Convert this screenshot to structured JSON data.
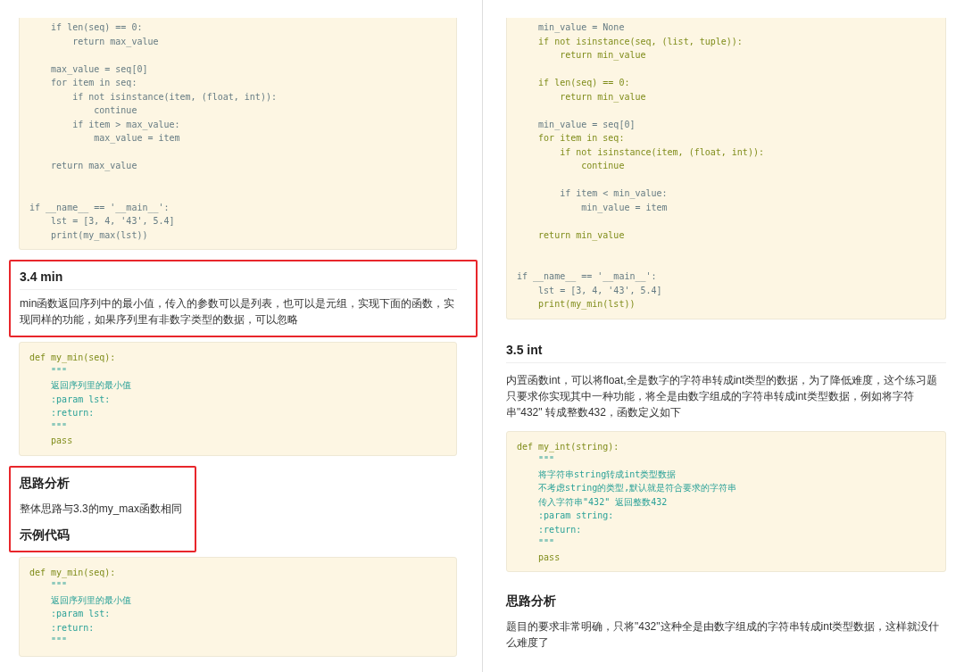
{
  "columns": [
    {
      "blocks": [
        {
          "kind": "code_continued",
          "lines": [
            {
              "kind": "plain",
              "text": "    if len(seq) == 0:"
            },
            {
              "kind": "plain",
              "text": "        return max_value"
            },
            {
              "kind": "blank"
            },
            {
              "kind": "plain",
              "text": "    max_value = seq[0]"
            },
            {
              "kind": "plain",
              "text": "    for item in seq:"
            },
            {
              "kind": "plain",
              "text": "        if not isinstance(item, (float, int)):"
            },
            {
              "kind": "plain",
              "text": "            continue"
            },
            {
              "kind": "plain",
              "text": "        if item > max_value:"
            },
            {
              "kind": "plain",
              "text": "            max_value = item"
            },
            {
              "kind": "blank"
            },
            {
              "kind": "plain",
              "text": "    return max_value"
            },
            {
              "kind": "blank"
            },
            {
              "kind": "blank"
            },
            {
              "kind": "plain",
              "text": "if __name__ == '__main__':"
            },
            {
              "kind": "plain",
              "text": "    lst = [3, 4, '43', 5.4]"
            },
            {
              "kind": "plain",
              "text": "    print(my_max(lst))"
            }
          ]
        },
        {
          "kind": "group",
          "highlighted": true,
          "wide": true,
          "blocks": [
            {
              "kind": "section_heading",
              "text": "3.4 min"
            },
            {
              "kind": "paragraph",
              "text": "min函数返回序列中的最小值，传入的参数可以是列表，也可以是元组，实现下面的函数，实现同样的功能，如果序列里有非数字类型的数据，可以忽略"
            }
          ]
        },
        {
          "kind": "code",
          "lines": [
            {
              "kind": "keyword",
              "text": "def my_min(seq):"
            },
            {
              "kind": "doc",
              "text": "    \"\"\""
            },
            {
              "kind": "doc",
              "text": "    返回序列里的最小值"
            },
            {
              "kind": "doc",
              "text": "    :param lst:"
            },
            {
              "kind": "doc",
              "text": "    :return:"
            },
            {
              "kind": "doc",
              "text": "    \"\"\""
            },
            {
              "kind": "keyword",
              "text": "    pass"
            }
          ]
        },
        {
          "kind": "group",
          "highlighted": true,
          "wide": false,
          "blocks": [
            {
              "kind": "heading",
              "text": "思路分析"
            },
            {
              "kind": "paragraph",
              "text": "整体思路与3.3的my_max函数相同"
            },
            {
              "kind": "heading",
              "text": "示例代码"
            }
          ]
        },
        {
          "kind": "code",
          "lines": [
            {
              "kind": "keyword",
              "text": "def my_min(seq):"
            },
            {
              "kind": "doc",
              "text": "    \"\"\""
            },
            {
              "kind": "doc",
              "text": "    返回序列里的最小值"
            },
            {
              "kind": "doc",
              "text": "    :param lst:"
            },
            {
              "kind": "doc",
              "text": "    :return:"
            },
            {
              "kind": "doc",
              "text": "    \"\"\""
            }
          ]
        }
      ]
    },
    {
      "blocks": [
        {
          "kind": "code_continued",
          "lines": [
            {
              "kind": "plain",
              "text": "    min_value = None"
            },
            {
              "kind": "keyword",
              "text": "    if not isinstance(seq, (list, tuple)):"
            },
            {
              "kind": "keyword",
              "text": "        return min_value"
            },
            {
              "kind": "blank"
            },
            {
              "kind": "keyword",
              "text": "    if len(seq) == 0:"
            },
            {
              "kind": "keyword",
              "text": "        return min_value"
            },
            {
              "kind": "blank"
            },
            {
              "kind": "plain",
              "text": "    min_value = seq[0]"
            },
            {
              "kind": "keyword",
              "text": "    for item in seq:"
            },
            {
              "kind": "keyword",
              "text": "        if not isinstance(item, (float, int)):"
            },
            {
              "kind": "keyword",
              "text": "            continue"
            },
            {
              "kind": "blank"
            },
            {
              "kind": "plain",
              "text": "        if item < min_value:"
            },
            {
              "kind": "plain",
              "text": "            min_value = item"
            },
            {
              "kind": "blank"
            },
            {
              "kind": "keyword",
              "text": "    return min_value"
            },
            {
              "kind": "blank"
            },
            {
              "kind": "blank"
            },
            {
              "kind": "plain",
              "text": "if __name__ == '__main__':"
            },
            {
              "kind": "plain",
              "text": "    lst = [3, 4, '43', 5.4]"
            },
            {
              "kind": "keyword",
              "text": "    print(my_min(lst))"
            }
          ]
        },
        {
          "kind": "section_heading",
          "text": "3.5 int"
        },
        {
          "kind": "paragraph",
          "text": "内置函数int，可以将float,全是数字的字符串转成int类型的数据，为了降低难度，这个练习题只要求你实现其中一种功能，将全是由数字组成的字符串转成int类型数据，例如将字符串\"432\" 转成整数432，函数定义如下"
        },
        {
          "kind": "code",
          "lines": [
            {
              "kind": "keyword",
              "text": "def my_int(string):"
            },
            {
              "kind": "doc",
              "text": "    \"\"\""
            },
            {
              "kind": "doc",
              "text": "    将字符串string转成int类型数据"
            },
            {
              "kind": "doc",
              "text": "    不考虑string的类型,默认就是符合要求的字符串"
            },
            {
              "kind": "doc",
              "text": "    传入字符串\"432\" 返回整数432"
            },
            {
              "kind": "doc",
              "text": "    :param string:"
            },
            {
              "kind": "doc",
              "text": "    :return:"
            },
            {
              "kind": "doc",
              "text": "    \"\"\""
            },
            {
              "kind": "keyword",
              "text": "    pass"
            }
          ]
        },
        {
          "kind": "heading",
          "text": "思路分析"
        },
        {
          "kind": "paragraph",
          "text": "题目的要求非常明确，只将\"432\"这种全是由数字组成的字符串转成int类型数据，这样就没什么难度了"
        }
      ]
    }
  ]
}
